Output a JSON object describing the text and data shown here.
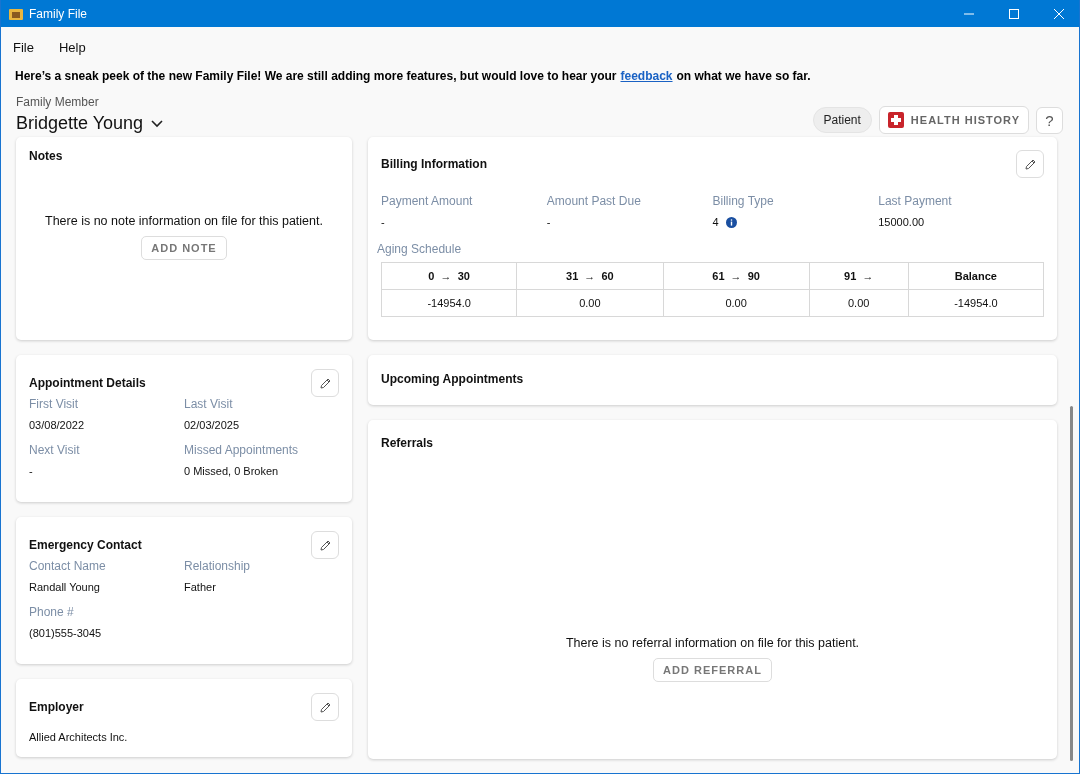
{
  "window": {
    "title": "Family File"
  },
  "menu": [
    "File",
    "Help"
  ],
  "banner": {
    "before": "Here’s a sneak peek of the new Family File! We are still adding more features,  but would love to hear your",
    "link": "feedback",
    "after": "on what we have so far."
  },
  "member": {
    "label": "Family Member",
    "name": "Bridgette Young"
  },
  "header_buttons": {
    "patient": "Patient",
    "health_history": "HEALTH HISTORY",
    "help": "?"
  },
  "left_cards": [
    {
      "kind": "empty",
      "title": "Notes",
      "editable": false,
      "message": "There is no note information on file for this patient.",
      "action": "ADD NOTE"
    },
    {
      "kind": "fields",
      "title": "Appointment Details",
      "editable": true,
      "fields": [
        {
          "label": "First Visit",
          "value": "03/08/2022"
        },
        {
          "label": "Last Visit",
          "value": "02/03/2025"
        },
        {
          "label": "Next Visit",
          "value": "-"
        },
        {
          "label": "Missed Appointments",
          "value": "0 Missed, 0 Broken"
        }
      ]
    },
    {
      "kind": "fields",
      "title": "Emergency Contact",
      "editable": true,
      "fields": [
        {
          "label": "Contact Name",
          "value": "Randall Young"
        },
        {
          "label": "Relationship",
          "value": "Father"
        },
        {
          "label": "Phone #",
          "value": "(801)555-3045"
        }
      ]
    },
    {
      "kind": "plain",
      "title": "Employer",
      "editable": true,
      "text": "Allied Architects Inc."
    }
  ],
  "right_cards": [
    {
      "kind": "billing",
      "title": "Billing Information",
      "editable": true,
      "fields": [
        {
          "label": "Payment Amount",
          "value": "-",
          "info": false
        },
        {
          "label": "Amount Past Due",
          "value": "-",
          "info": false
        },
        {
          "label": "Billing Type",
          "value": "4",
          "info": true
        },
        {
          "label": "Last Payment",
          "value": "15000.00",
          "info": false
        }
      ],
      "aging_label": "Aging Schedule",
      "aging_columns": [
        "0  →  30",
        "31  →  60",
        "61  →  90",
        "91  →",
        "Balance"
      ],
      "aging_values": [
        "-14954.0",
        "0.00",
        "0.00",
        "0.00",
        "-14954.0"
      ]
    },
    {
      "kind": "blank",
      "title": "Upcoming Appointments",
      "editable": false
    },
    {
      "kind": "empty",
      "title": "Referrals",
      "editable": false,
      "message": "There is no referral information on file for this patient.",
      "action": "ADD REFERRAL"
    }
  ]
}
